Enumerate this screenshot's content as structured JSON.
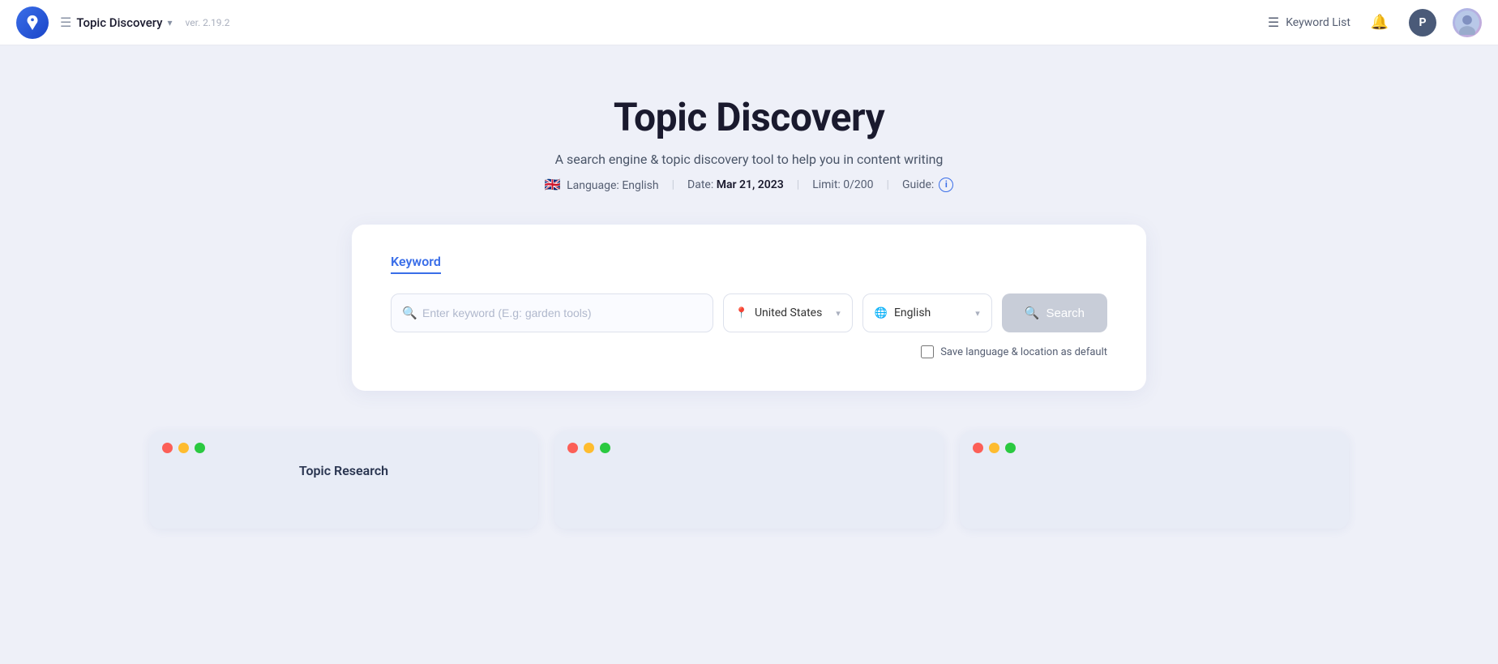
{
  "app": {
    "logo_alt": "App Logo",
    "title": "Topic Discovery",
    "version": "ver. 2.19.2",
    "chevron": "▾",
    "keyword_list_label": "Keyword List",
    "bell_label": "Notifications",
    "p_badge": "P"
  },
  "hero": {
    "title": "Topic Discovery",
    "subtitle": "A search engine & topic discovery tool to help you in content writing",
    "language_label": "Language:",
    "language_flag": "🇬🇧",
    "language_value": "English",
    "date_label": "Date:",
    "date_value": "Mar 21, 2023",
    "limit_label": "Limit:",
    "limit_value": "0/200",
    "guide_label": "Guide:",
    "guide_icon": "i"
  },
  "search": {
    "tab_label": "Keyword",
    "input_placeholder": "Enter keyword (E.g: garden tools)",
    "location_label": "United States",
    "location_icon": "📍",
    "language_label": "English",
    "language_icon": "🌐",
    "search_button": "Search",
    "save_default_label": "Save language & location as default"
  },
  "bottom_cards": [
    {
      "title": "Topic Research"
    },
    {
      "title": ""
    },
    {
      "title": ""
    }
  ]
}
